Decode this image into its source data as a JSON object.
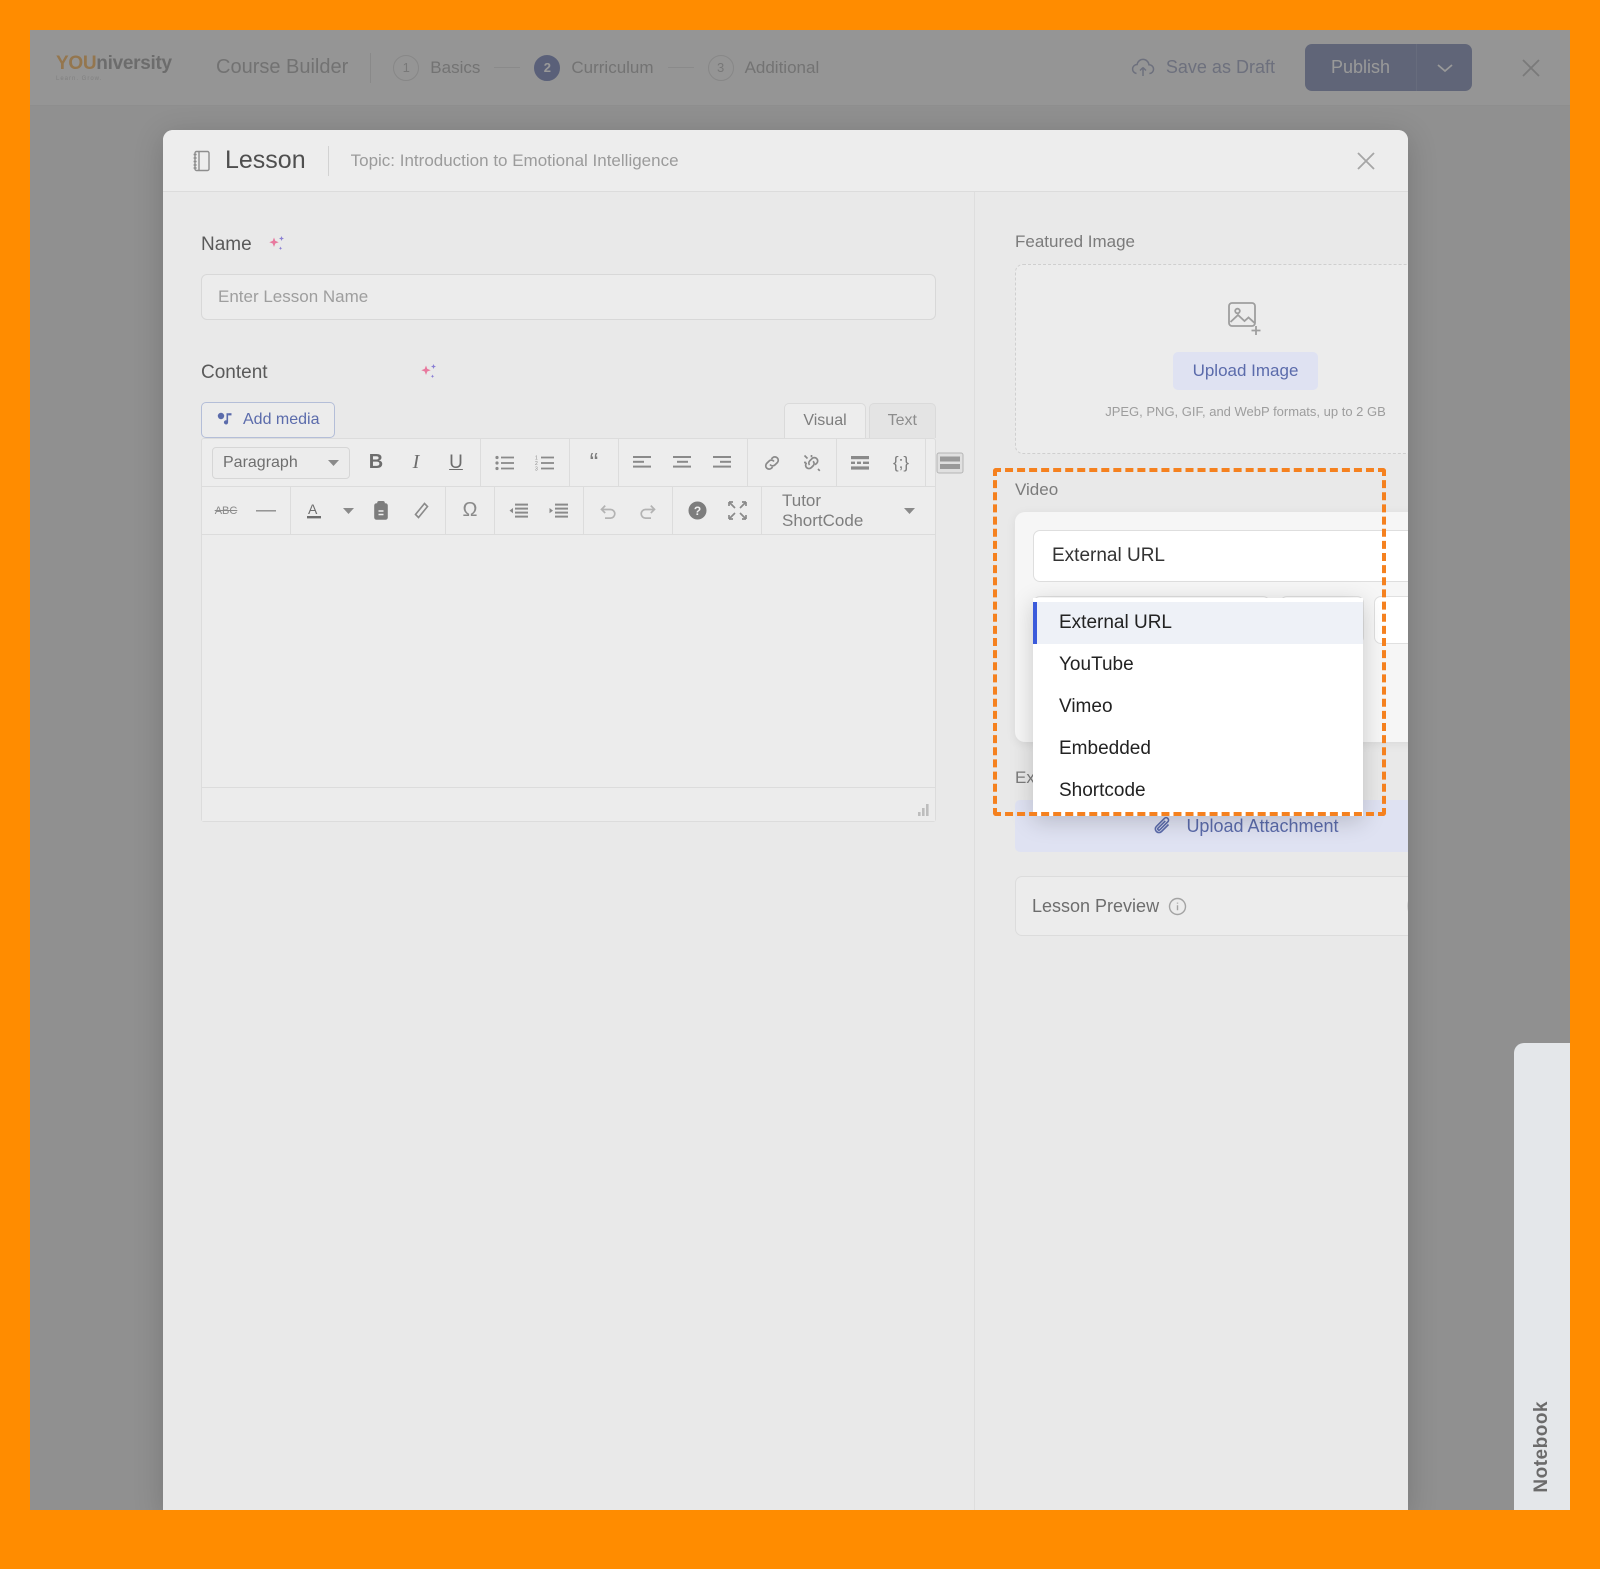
{
  "app": {
    "brand_primary": "YOU",
    "brand_secondary": "niversity",
    "brand_tagline": "Learn. Grow.",
    "accent_orange": "#f5811f",
    "accent_blue": "#5b6bab"
  },
  "topbar": {
    "title": "Course Builder",
    "steps": [
      {
        "num": "1",
        "label": "Basics",
        "active": false
      },
      {
        "num": "2",
        "label": "Curriculum",
        "active": true
      },
      {
        "num": "3",
        "label": "Additional",
        "active": false
      }
    ],
    "save_draft_label": "Save as Draft",
    "publish_label": "Publish",
    "publish_caret_icon": "chevron-down-icon",
    "close_icon": "close-icon"
  },
  "modal": {
    "icon": "lesson-icon",
    "title": "Lesson",
    "topic": "Topic: Introduction to Emotional Intelligence",
    "close_icon": "close-icon"
  },
  "left": {
    "name_label": "Name",
    "name_sparkle_icon": "ai-sparkle-icon",
    "name_placeholder": "Enter Lesson Name",
    "name_value": "",
    "content_label": "Content",
    "content_sparkle_icon": "ai-sparkle-icon",
    "add_media_label": "Add media",
    "add_media_icon": "media-icon",
    "tabs": [
      {
        "label": "Visual",
        "active": true
      },
      {
        "label": "Text",
        "active": false
      }
    ],
    "toolbar_row1": {
      "format_select": "Paragraph",
      "buttons": [
        {
          "name": "bold-icon",
          "glyph": "B"
        },
        {
          "name": "italic-icon",
          "glyph": "I"
        },
        {
          "name": "underline-icon",
          "glyph": "U"
        },
        {
          "name": "bulleted-list-icon",
          "glyph": ""
        },
        {
          "name": "numbered-list-icon",
          "glyph": ""
        },
        {
          "name": "blockquote-icon",
          "glyph": "“"
        },
        {
          "name": "align-left-icon",
          "glyph": ""
        },
        {
          "name": "align-center-icon",
          "glyph": ""
        },
        {
          "name": "align-right-icon",
          "glyph": ""
        },
        {
          "name": "insert-link-icon",
          "glyph": ""
        },
        {
          "name": "remove-link-icon",
          "glyph": ""
        },
        {
          "name": "read-more-icon",
          "glyph": ""
        },
        {
          "name": "code-icon",
          "glyph": "{;}"
        },
        {
          "name": "toggle-toolbar-icon",
          "glyph": ""
        }
      ]
    },
    "toolbar_row2": {
      "buttons": [
        {
          "name": "strikethrough-icon",
          "glyph": "ABC"
        },
        {
          "name": "horizontal-rule-icon",
          "glyph": "—"
        },
        {
          "name": "text-color-icon",
          "glyph": "A"
        },
        {
          "name": "text-color-dropdown-icon",
          "glyph": "▾"
        },
        {
          "name": "paste-as-text-icon",
          "glyph": ""
        },
        {
          "name": "clear-formatting-icon",
          "glyph": ""
        },
        {
          "name": "special-character-icon",
          "glyph": "Ω"
        },
        {
          "name": "decrease-indent-icon",
          "glyph": ""
        },
        {
          "name": "increase-indent-icon",
          "glyph": ""
        },
        {
          "name": "undo-icon",
          "glyph": ""
        },
        {
          "name": "redo-icon",
          "glyph": ""
        },
        {
          "name": "keyboard-shortcuts-icon",
          "glyph": "?"
        },
        {
          "name": "fullscreen-icon",
          "glyph": ""
        }
      ],
      "shortcode_label": "Tutor ShortCode",
      "shortcode_caret_icon": "caret-down-icon"
    },
    "editor_content": "",
    "resize_handle_icon": "resize-handle-icon"
  },
  "right": {
    "featured": {
      "label": "Featured Image",
      "placeholder_icon": "image-add-icon",
      "upload_label": "Upload Image",
      "hint": "JPEG, PNG, GIF, and WebP formats, up to 2 GB"
    },
    "video": {
      "label": "Video",
      "selected_source": "External URL",
      "caret_icon": "chevron-up-icon",
      "options": [
        {
          "label": "External URL",
          "selected": true
        },
        {
          "label": "YouTube",
          "selected": false
        },
        {
          "label": "Vimeo",
          "selected": false
        },
        {
          "label": "Embedded",
          "selected": false
        },
        {
          "label": "Shortcode",
          "selected": false
        }
      ],
      "url_placeholder": "",
      "url_value": "",
      "highlight_color": "#f5811f"
    },
    "exercise": {
      "label": "Exercise Files",
      "upload_label": "Upload Attachment",
      "upload_icon": "paperclip-icon"
    },
    "preview": {
      "label": "Lesson Preview",
      "info_icon": "info-icon",
      "toggle_state": "off"
    }
  },
  "notebook": {
    "label": "Notebook"
  }
}
